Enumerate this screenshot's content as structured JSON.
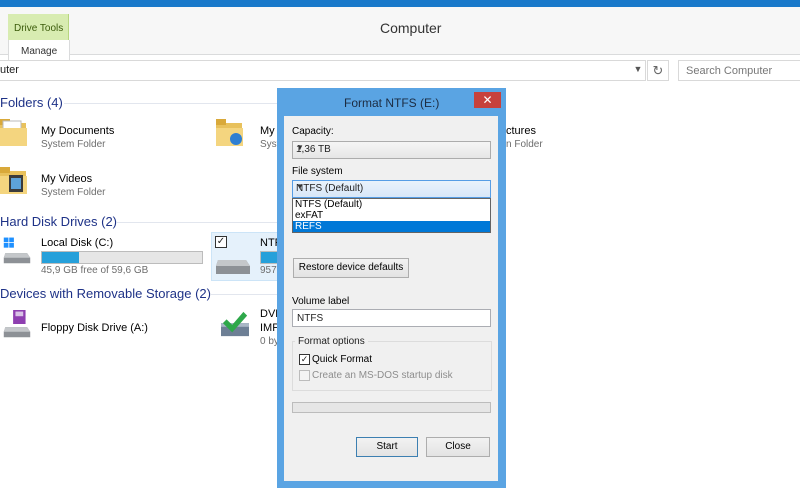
{
  "window": {
    "title": "Computer"
  },
  "ribbon": {
    "context_tab_group": "Drive Tools",
    "context_tab": "Manage"
  },
  "address": {
    "text": "uter",
    "search_placeholder": "Search Computer"
  },
  "groups": [
    {
      "header": "Folders (4)"
    },
    {
      "header": "Hard Disk Drives (2)"
    },
    {
      "header": "Devices with Removable Storage (2)"
    }
  ],
  "folders": [
    {
      "name": "My Documents",
      "type": "System Folder"
    },
    {
      "name": "My",
      "type": "Syst"
    },
    {
      "name": "ctures",
      "type": "n Folder"
    },
    {
      "name": "My Videos",
      "type": "System Folder"
    }
  ],
  "drives": [
    {
      "name": "Local Disk (C:)",
      "detail": "45,9 GB free of 59,6 GB",
      "used_fraction": 0.23
    },
    {
      "name": "NTF",
      "detail": "957",
      "used_fraction": 0.3
    }
  ],
  "removable": [
    {
      "name": "Floppy Disk Drive (A:)"
    },
    {
      "name": "DVD",
      "line2": "IMP",
      "line3": "0 by"
    }
  ],
  "dialog": {
    "title": "Format NTFS (E:)",
    "close": "✕",
    "capacity_label": "Capacity:",
    "capacity_value": "1,36 TB",
    "filesystem_label": "File system",
    "filesystem_value": "NTFS (Default)",
    "filesystem_options": [
      "NTFS (Default)",
      "exFAT",
      "REFS"
    ],
    "filesystem_highlighted": "REFS",
    "restore_button": "Restore device defaults",
    "volume_label": "Volume label",
    "volume_value": "NTFS",
    "format_options_label": "Format options",
    "quick_format": "Quick Format",
    "quick_format_checked": true,
    "msdos_disk": "Create an MS-DOS startup disk",
    "msdos_checked": false,
    "start_button": "Start",
    "close_button": "Close",
    "progress": 0
  },
  "colors": {
    "accent": "#1979ca",
    "group_header": "#1e3287",
    "capacity_fill": "#26a0da",
    "close_red": "#c7413c",
    "selection": "#0078d7"
  }
}
